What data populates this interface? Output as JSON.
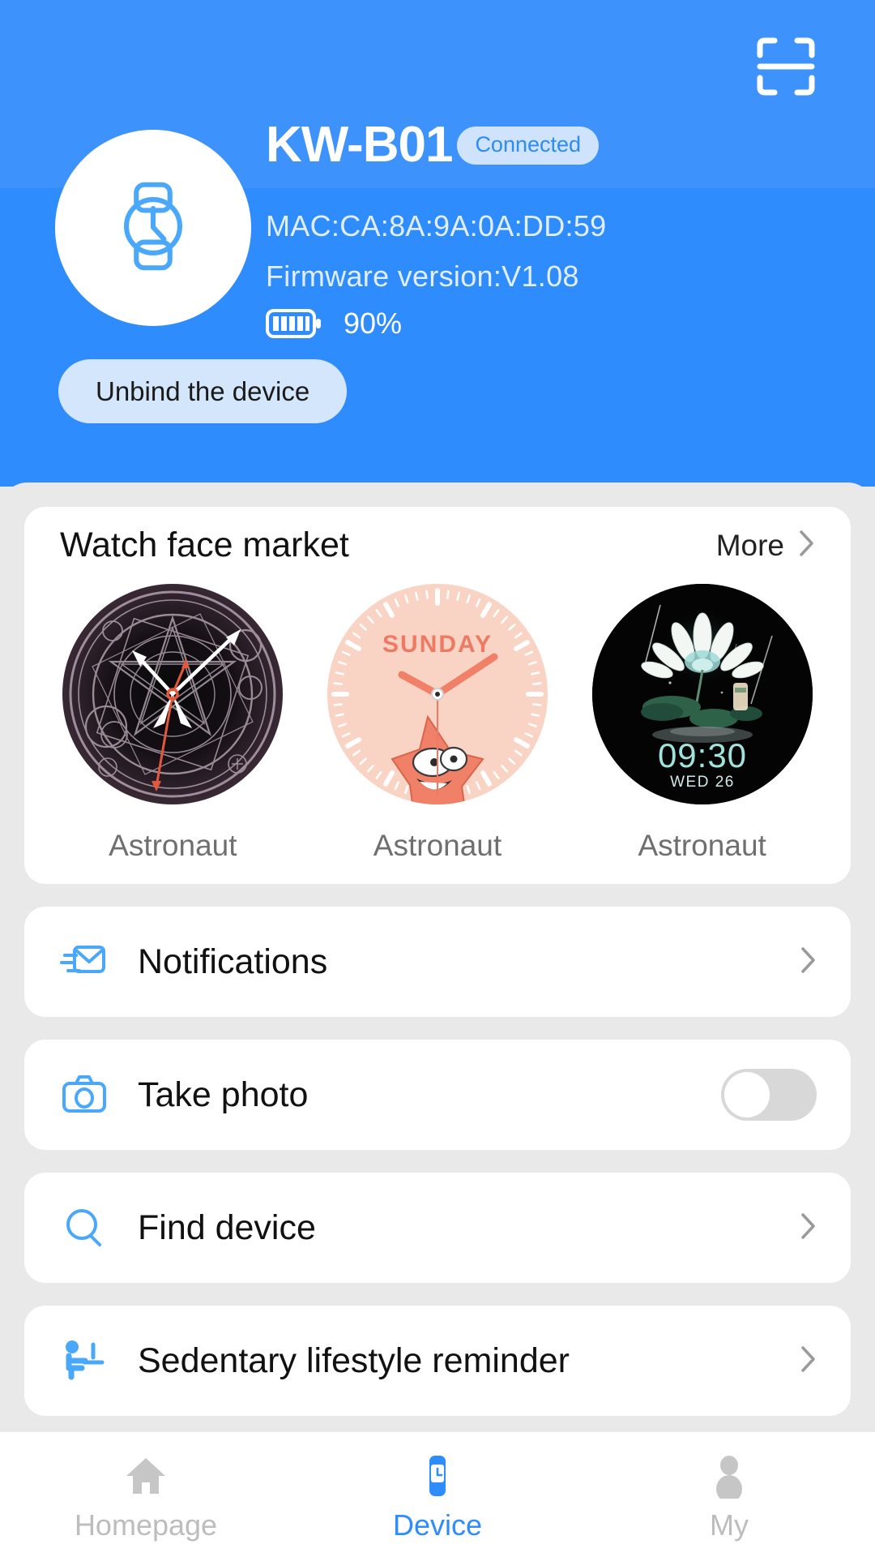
{
  "theme": {
    "brand_blue": "#2e8cfc",
    "header_top_blue": "#3d92fb",
    "badge_bg": "#cfe3fc",
    "badge_text": "#2a8cf5",
    "unbind_bg": "#d3e6fc",
    "sheet_bg": "#e9e9e9",
    "card_bg": "#ffffff",
    "icon_blue": "#4aa8fb",
    "toggle_off": "#d8d8d8",
    "nav_inactive": "#bdbdbd"
  },
  "header": {
    "scan_icon": "scan-qr-icon",
    "avatar_icon": "watch-icon",
    "device_name": "KW-B01",
    "connection_status": "Connected",
    "mac": "MAC:CA:8A:9A:0A:DD:59",
    "firmware": "Firmware version:V1.08",
    "battery_icon": "battery-icon",
    "battery_level": "90%",
    "battery_bars": 5,
    "unbind_label": "Unbind the device"
  },
  "watch_face_market": {
    "title": "Watch face market",
    "more_label": "More",
    "more_chevron": "chevron-right-icon",
    "faces": [
      {
        "label": "Astronaut",
        "style": "magic-circle",
        "preview_text": ""
      },
      {
        "label": "Astronaut",
        "style": "sunday-starfish",
        "preview_text": "SUNDAY"
      },
      {
        "label": "Astronaut",
        "style": "lotus-night",
        "preview_time": "09:30",
        "preview_date": "WED 26"
      }
    ]
  },
  "menu": {
    "rows": [
      {
        "label": "Notifications",
        "icon": "envelope-icon",
        "control": "chevron"
      },
      {
        "label": "Take photo",
        "icon": "camera-icon",
        "control": "toggle",
        "toggle_on": false
      },
      {
        "label": "Find device",
        "icon": "search-icon",
        "control": "chevron"
      },
      {
        "label": "Sedentary lifestyle reminder",
        "icon": "sedentary-person-icon",
        "control": "chevron"
      }
    ]
  },
  "bottom_nav": {
    "items": [
      {
        "label": "Homepage",
        "icon": "home-icon",
        "active": false
      },
      {
        "label": "Device",
        "icon": "watch-icon",
        "active": true
      },
      {
        "label": "My",
        "icon": "person-icon",
        "active": false
      }
    ]
  }
}
